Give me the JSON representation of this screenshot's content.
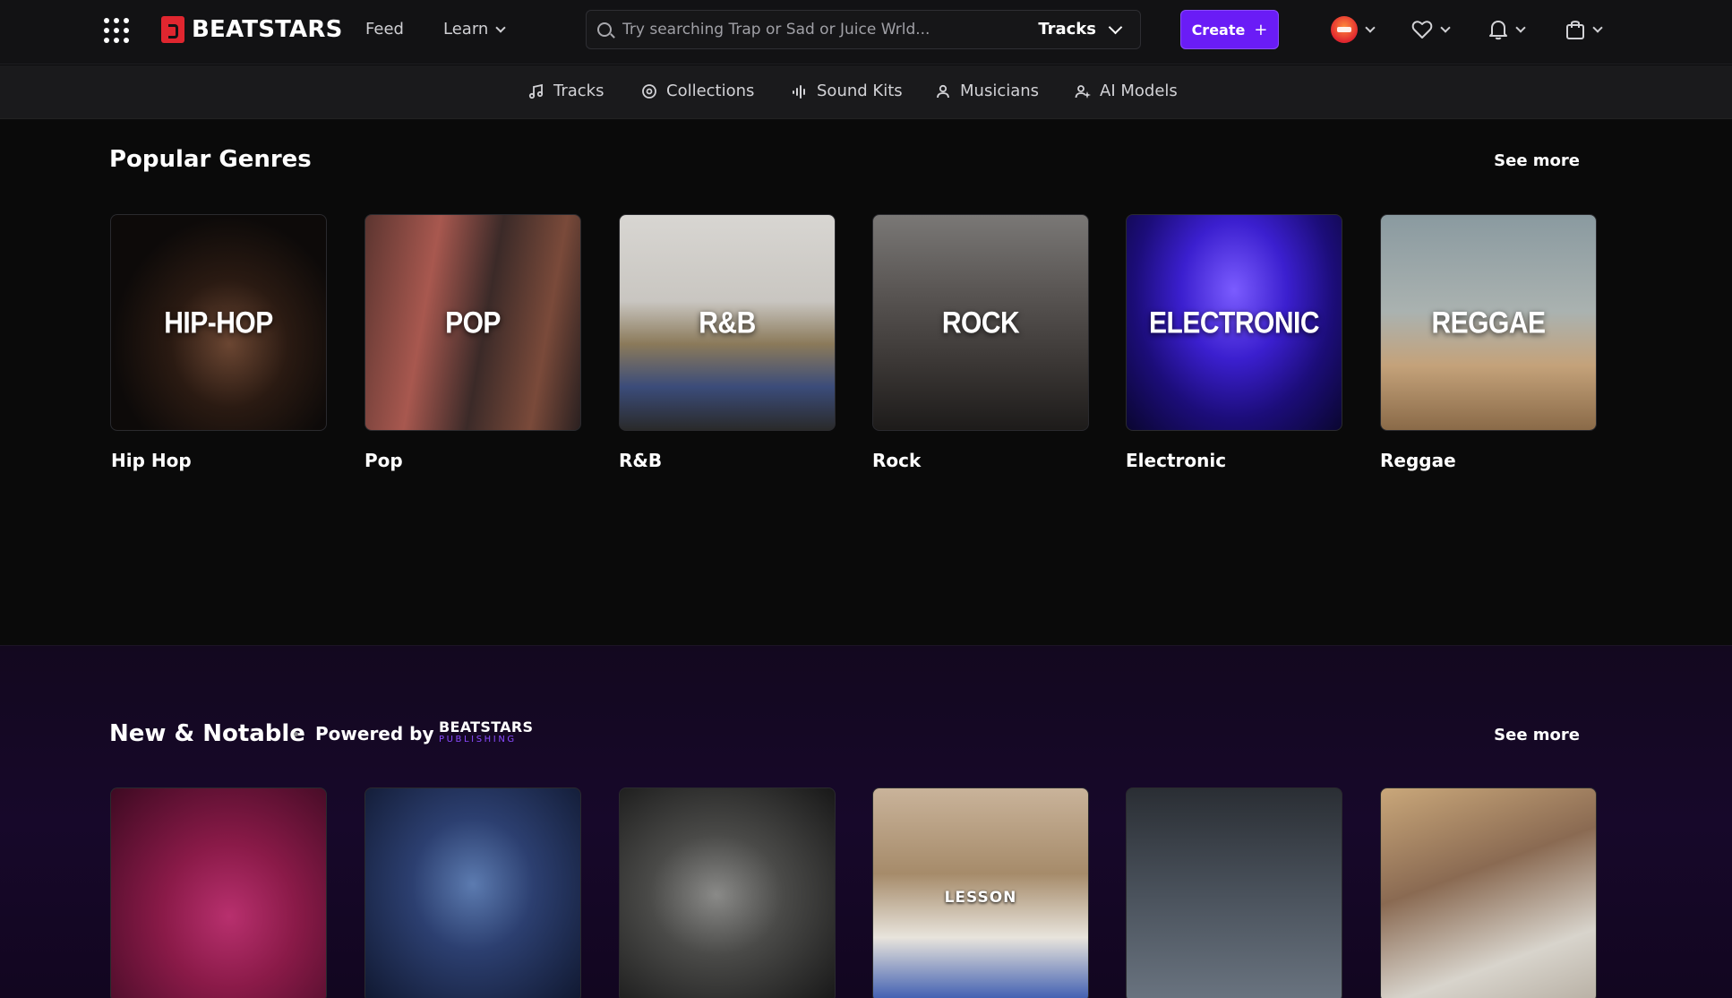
{
  "topbar": {
    "logo_text": "BEATSTARS",
    "nav": {
      "feed": "Feed",
      "learn": "Learn"
    },
    "search": {
      "placeholder": "Try searching Trap or Sad or Juice Wrld...",
      "scope": "Tracks"
    },
    "create_label": "Create",
    "icons": [
      "apps-grid-icon",
      "avatar",
      "heart-icon",
      "bell-icon",
      "bag-icon"
    ]
  },
  "subnav": {
    "items": [
      {
        "label": "Tracks",
        "icon": "music-note-icon"
      },
      {
        "label": "Collections",
        "icon": "disc-icon"
      },
      {
        "label": "Sound Kits",
        "icon": "waveform-icon"
      },
      {
        "label": "Musicians",
        "icon": "person-icon"
      },
      {
        "label": "AI Models",
        "icon": "person-sparkle-icon"
      }
    ]
  },
  "popular_genres": {
    "title": "Popular Genres",
    "see_more": "See more",
    "items": [
      {
        "overlay": "HIP-HOP",
        "label": "Hip Hop"
      },
      {
        "overlay": "POP",
        "label": "Pop"
      },
      {
        "overlay": "R&B",
        "label": "R&B"
      },
      {
        "overlay": "ROCK",
        "label": "Rock"
      },
      {
        "overlay": "ELECTRONIC",
        "label": "Electronic"
      },
      {
        "overlay": "REGGAE",
        "label": "Reggae"
      }
    ]
  },
  "new_notable": {
    "title": "New & Notable",
    "powered_by": "Powered by",
    "publisher_line1": "BEATSTARS",
    "publisher_line2": "PUBLISHING",
    "see_more": "See more",
    "card4_overlay": "LESSON"
  },
  "colors": {
    "accent": "#6a1cf6",
    "brand_red": "#e0262f",
    "publishing_purple": "#8a4bff"
  }
}
